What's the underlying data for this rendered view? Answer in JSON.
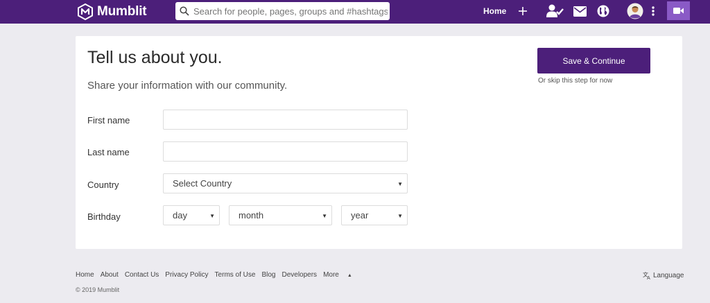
{
  "brand": {
    "name": "Mumblit"
  },
  "header": {
    "search_placeholder": "Search for people, pages, groups and #hashtags",
    "home_label": "Home",
    "icons": [
      "plus-icon",
      "user-check-icon",
      "envelope-icon",
      "globe-icon",
      "avatar",
      "more-vertical-icon",
      "video-camera-icon"
    ],
    "colors": {
      "bar": "#4c1f7a",
      "video_button": "#8a5ac6"
    }
  },
  "profile_form": {
    "title": "Tell us about you.",
    "subtitle": "Share your information with our community.",
    "first_name": {
      "label": "First name",
      "value": ""
    },
    "last_name": {
      "label": "Last name",
      "value": ""
    },
    "country": {
      "label": "Country",
      "selected": "Select Country"
    },
    "birthday": {
      "label": "Birthday",
      "day": "day",
      "month": "month",
      "year": "year"
    },
    "save_label": "Save & Continue",
    "skip_label": "Or skip this step for now"
  },
  "footer": {
    "links": [
      "Home",
      "About",
      "Contact Us",
      "Privacy Policy",
      "Terms of Use",
      "Blog",
      "Developers",
      "More"
    ],
    "copyright": "© 2019 Mumblit",
    "language_label": "Language"
  }
}
